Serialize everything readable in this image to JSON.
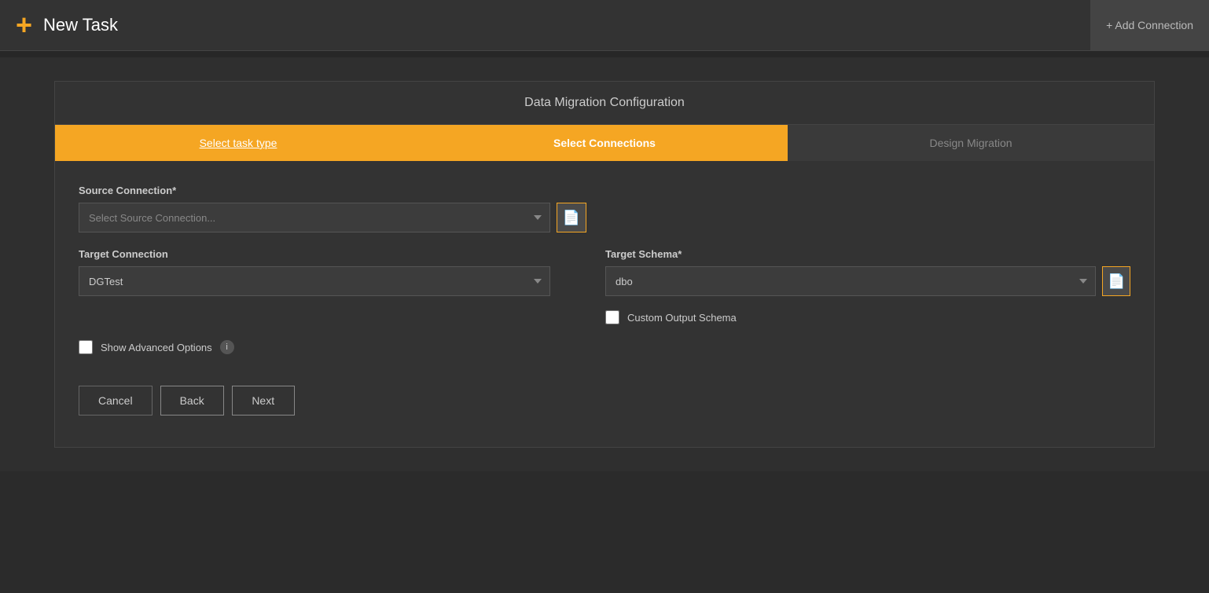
{
  "header": {
    "logo": "+",
    "title": "New Task",
    "add_connection_label": "+ Add Connection"
  },
  "wizard": {
    "title": "Data Migration Configuration",
    "steps": [
      {
        "label": "Select task type",
        "state": "completed"
      },
      {
        "label": "Select Connections",
        "state": "active"
      },
      {
        "label": "Design Migration",
        "state": "inactive"
      }
    ]
  },
  "form": {
    "source_connection": {
      "label": "Source Connection*",
      "placeholder": "Select Source Connection..."
    },
    "target_connection": {
      "label": "Target Connection",
      "value": "DGTest"
    },
    "target_schema": {
      "label": "Target Schema*",
      "value": "dbo"
    },
    "custom_output_schema": {
      "label": "Custom Output Schema",
      "checked": false
    },
    "show_advanced_options": {
      "label": "Show Advanced Options",
      "checked": false
    }
  },
  "buttons": {
    "cancel": "Cancel",
    "back": "Back",
    "next": "Next"
  },
  "icons": {
    "file": "🗋",
    "info": "i"
  }
}
